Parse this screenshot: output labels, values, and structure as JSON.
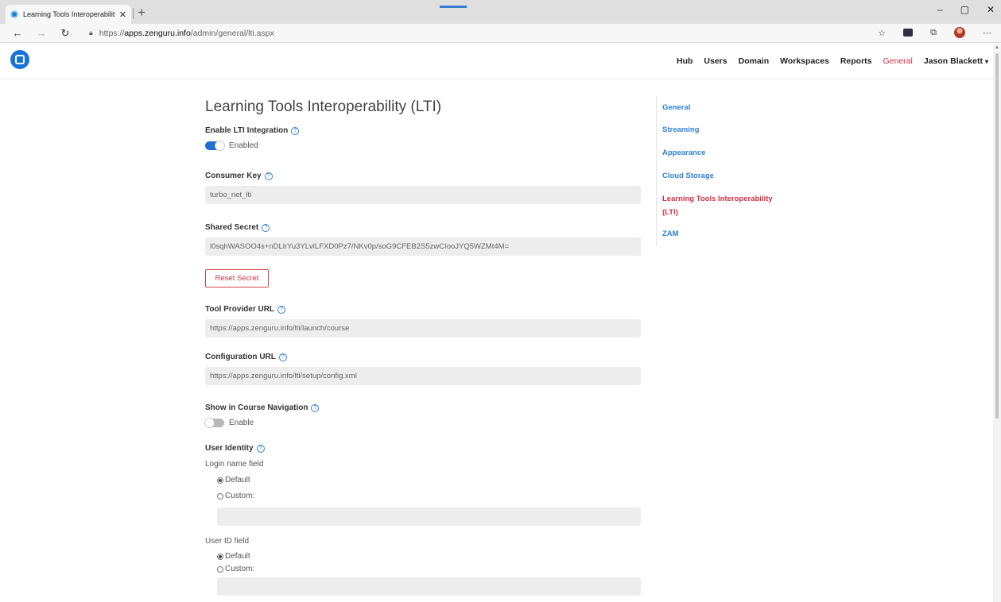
{
  "browser": {
    "tab_title": "Learning Tools Interoperability",
    "tab_close": "✕",
    "new_tab": "+",
    "window_controls": [
      "–",
      "▢",
      "✕"
    ],
    "url_scheme": "https://",
    "url_host": "apps.zenguru.info",
    "url_path": "/admin/general/lti.aspx",
    "nav_icons": [
      "back-icon",
      "forward-icon",
      "refresh-icon"
    ],
    "toolbar_icons": [
      "favorites-star-icon",
      "extension-icon",
      "collections-icon",
      "profile-avatar",
      "more-icon"
    ]
  },
  "header": {
    "nav": [
      "Hub",
      "Users",
      "Domain",
      "Workspaces",
      "Reports",
      "General"
    ],
    "active": "General",
    "user": "Jason Blackett",
    "caret": "▾"
  },
  "page": {
    "title": "Learning Tools Interoperability (LTI)",
    "enable_lti": {
      "label": "Enable LTI Integration",
      "state": "Enabled",
      "on": true
    },
    "consumer_key": {
      "label": "Consumer Key",
      "value": "turbo_net_lti"
    },
    "shared_secret": {
      "label": "Shared Secret",
      "value": "l0sqhWASOO4s+nDLlrYu3YLvlLFXD0Pz7/NKv0p/soG9CFEB2S5zwCIooJYQ5WZMt4M="
    },
    "reset_button": "Reset Secret",
    "tool_provider_url": {
      "label": "Tool Provider URL",
      "value": "https://apps.zenguru.info/lti/launch/course"
    },
    "configuration_url": {
      "label": "Configuration URL",
      "value": "https://apps.zenguru.info/lti/setup/config.xml"
    },
    "show_in_course_nav": {
      "label": "Show in Course Navigation",
      "state": "Enable",
      "on": false
    },
    "user_identity": {
      "label": "User Identity",
      "login_name_field": {
        "label": "Login name field",
        "options": [
          "Default",
          "Custom:"
        ],
        "selected": "Default",
        "custom_value": ""
      },
      "user_id_field": {
        "label": "User ID field",
        "options": [
          "Default",
          "Custom:"
        ],
        "selected": "Default",
        "custom_value": ""
      }
    },
    "help_glyph": "?"
  },
  "sidebar": {
    "items": [
      "General",
      "Streaming",
      "Appearance",
      "Cloud Storage",
      "Learning Tools Interoperability (LTI)",
      "ZAM"
    ],
    "active": "Learning Tools Interoperability (LTI)"
  },
  "colors": {
    "accent_blue": "#2f7fd8",
    "active_red": "#d23244",
    "toggle_on": "#1d6fd0",
    "field_bg": "#ededed"
  }
}
